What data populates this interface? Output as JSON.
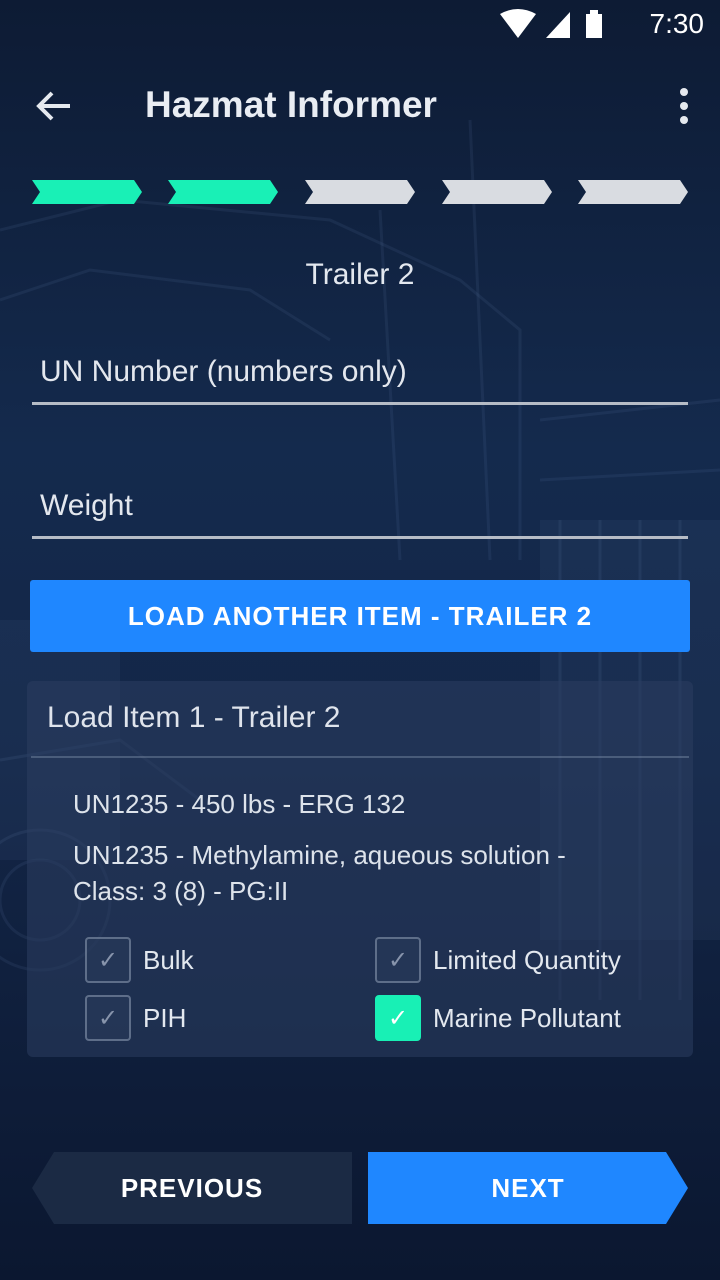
{
  "status_bar": {
    "time": "7:30",
    "icons": [
      "wifi-icon",
      "signal-icon",
      "battery-icon"
    ]
  },
  "app_bar": {
    "title": "Hazmat Informer",
    "back_icon": "arrow-left-icon",
    "menu_icon": "more-vertical-icon"
  },
  "stepper": {
    "total_steps": 5,
    "completed_steps": 2,
    "active_color": "#19f0b6",
    "inactive_color": "#d9dce1"
  },
  "form": {
    "subtitle": "Trailer 2",
    "un_number_placeholder": "UN Number (numbers only)",
    "weight_placeholder": "Weight",
    "load_button_label": "LOAD ANOTHER ITEM - TRAILER 2"
  },
  "load_item": {
    "title": "Load Item 1 - Trailer 2",
    "summary": "UN1235 - 450 lbs - ERG 132",
    "description": "UN1235 - Methylamine, aqueous solution - Class: 3 (8) - PG:II",
    "options": [
      {
        "label": "Bulk",
        "checked": false
      },
      {
        "label": "Limited Quantity",
        "checked": false
      },
      {
        "label": "PIH",
        "checked": false
      },
      {
        "label": "Marine Pollutant",
        "checked": true
      }
    ]
  },
  "navigation": {
    "previous_label": "PREVIOUS",
    "next_label": "NEXT"
  },
  "colors": {
    "accent": "#1f87ff",
    "success": "#18f0b5",
    "background": "#132647"
  }
}
